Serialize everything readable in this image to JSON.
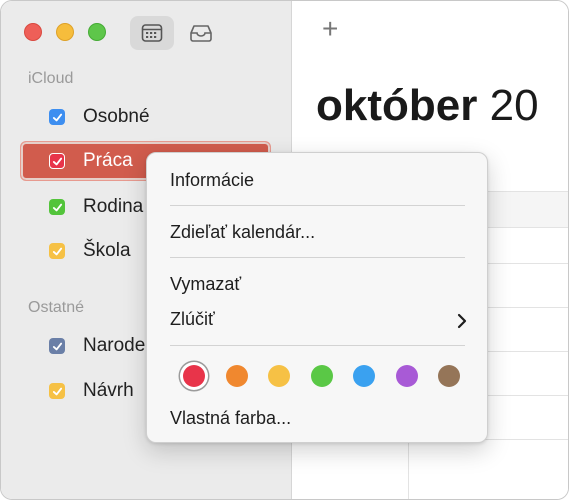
{
  "toolbar": {
    "calendar_icon": "calendar-icon",
    "inbox_icon": "inbox-icon",
    "add_label": "+"
  },
  "sidebar": {
    "icloud_header": "iCloud",
    "other_header": "Ostatné",
    "icloud_items": [
      {
        "label": "Osobné",
        "color": "#3d8ef0"
      },
      {
        "label": "Práca",
        "color": "#e8344a"
      },
      {
        "label": "Rodina",
        "color": "#53c43b"
      },
      {
        "label": "Škola",
        "color": "#f6c145"
      }
    ],
    "other_items": [
      {
        "label": "Narode",
        "color": "#6a7fa7"
      },
      {
        "label": "Návrh",
        "color": "#f6c145"
      }
    ]
  },
  "main": {
    "month_bold": "október",
    "year_fragment": "20"
  },
  "context_menu": {
    "info": "Informácie",
    "share": "Zdieľať kalendár...",
    "delete": "Vymazať",
    "merge": "Zlúčiť",
    "custom_color": "Vlastná farba...",
    "submenu_icon": "chevron-right-icon",
    "colors": [
      "#e8344a",
      "#f0882f",
      "#f6c145",
      "#5ac846",
      "#3aa1f0",
      "#a85ad6",
      "#957558"
    ],
    "selected_color": "#e8344a"
  }
}
